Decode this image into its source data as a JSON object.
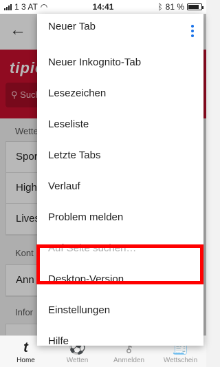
{
  "status_bar": {
    "carrier": "1 3 AT",
    "time": "14:41",
    "battery": "81 %",
    "battery_level": 0.81
  },
  "page": {
    "logo": "tipico",
    "search_placeholder": "Such",
    "sections": [
      {
        "title": "Wette",
        "rows": [
          "Spor",
          "High",
          "Lives"
        ]
      },
      {
        "title": "Kont",
        "rows": [
          "Ann"
        ]
      },
      {
        "title": "Infor",
        "rows": []
      }
    ]
  },
  "menu": {
    "items": [
      {
        "label": "Neuer Tab",
        "enabled": true
      },
      {
        "label": "Neuer Inkognito-Tab",
        "enabled": true
      },
      {
        "label": "Lesezeichen",
        "enabled": true
      },
      {
        "label": "Leseliste",
        "enabled": true
      },
      {
        "label": "Letzte Tabs",
        "enabled": true
      },
      {
        "label": "Verlauf",
        "enabled": true
      },
      {
        "label": "Problem melden",
        "enabled": true
      },
      {
        "label": "Auf Seite suchen…",
        "enabled": false
      },
      {
        "label": "Desktop-Version",
        "enabled": true
      },
      {
        "label": "Einstellungen",
        "enabled": true
      },
      {
        "label": "Hilfe",
        "enabled": true
      }
    ],
    "highlight_color": "#ff0000"
  },
  "tabbar": {
    "tabs": [
      {
        "label": "Home",
        "icon": "tipico-t-icon",
        "active": true
      },
      {
        "label": "Wetten",
        "icon": "soccer-ball-icon",
        "active": false
      },
      {
        "label": "Anmelden",
        "icon": "key-icon",
        "active": false
      },
      {
        "label": "Wettschein",
        "icon": "receipt-icon",
        "active": false
      }
    ]
  },
  "colors": {
    "brand": "#c8102e",
    "accent": "#1a73e8"
  }
}
